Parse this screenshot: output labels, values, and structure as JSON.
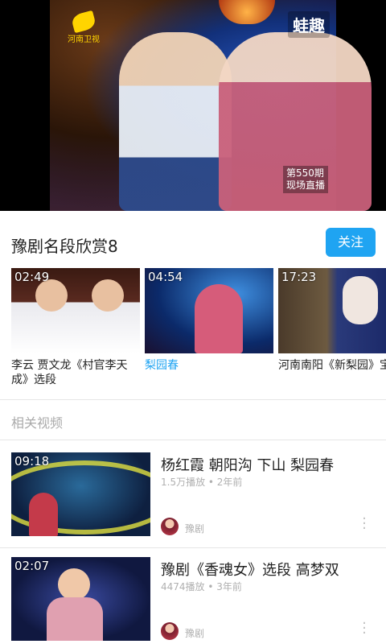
{
  "player": {
    "watermark": "蛙趣",
    "station_name": "河南卫视",
    "overlay_episode": "第550期",
    "overlay_live": "现场直播"
  },
  "channel": {
    "title": "豫剧名段欣赏8",
    "follow_label": "关注"
  },
  "featured": [
    {
      "duration": "02:49",
      "title": "李云 贾文龙《村官李天成》选段"
    },
    {
      "duration": "04:54",
      "title": "梨园春"
    },
    {
      "duration": "17:23",
      "title": "河南南阳《新梨园》宝英弟子 崔玉萍《秦"
    }
  ],
  "related": {
    "header": "相关视频",
    "items": [
      {
        "duration": "09:18",
        "title": "杨红霞 朝阳沟 下山 梨园春",
        "meta": "1.5万播放 • 2年前",
        "author": "豫剧"
      },
      {
        "duration": "02:07",
        "title": "豫剧《香魂女》选段 高梦双",
        "meta": "4474播放 • 3年前",
        "author": "豫剧"
      }
    ]
  },
  "colors": {
    "accent": "#1fa4f2",
    "secondary_text": "#b0b0b0"
  }
}
